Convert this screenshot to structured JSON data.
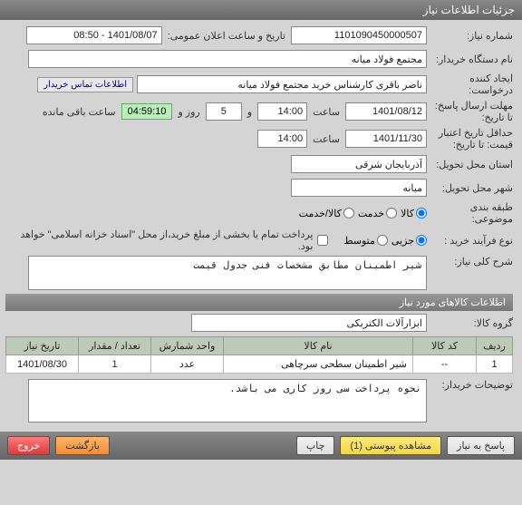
{
  "titlebar": "جزئیات اطلاعات نیاز",
  "labels": {
    "need_no": "شماره نیاز:",
    "announce_dt": "تاریخ و ساعت اعلان عمومی:",
    "buyer_org": "نام دستگاه خریدار:",
    "requester": "ایجاد کننده درخواست:",
    "contact_info": "اطلاعات تماس خریدار",
    "deadline": "مهلت ارسال پاسخ: تا تاریخ:",
    "time": "ساعت",
    "and": "و",
    "day": "روز و",
    "remaining": "ساعت باقی مانده",
    "validity": "حداقل تاریخ اعتبار قیمت: تا تاریخ:",
    "province": "استان محل تحویل:",
    "city": "شهر محل تحویل:",
    "subject_class": "طبقه بندی موضوعی:",
    "goods": "کالا",
    "service": "خدمت",
    "goods_service": "کالا/خدمت",
    "purchase_type": "نوع فرآیند خرید :",
    "partial": "جزیی",
    "medium": "متوسط",
    "payment_note": "پرداخت تمام یا بخشی از مبلغ خرید،از محل \"اسناد خزانه اسلامی\" خواهد بود.",
    "need_desc": "شرح کلی نیاز:",
    "goods_info_header": "اطلاعات کالاهای مورد نیاز",
    "goods_group": "گروه کالا:",
    "buyer_notes": "توضیحات خریدار:"
  },
  "fields": {
    "need_no": "1101090450000507",
    "announce_dt": "1401/08/07 - 08:50",
    "buyer_org": "مجتمع فولاد میانه",
    "requester": "ناصر باقری کارشناس خرید مجتمع فولاد میانه",
    "deadline_date": "1401/08/12",
    "deadline_time": "14:00",
    "days_left": "5",
    "countdown": "04:59:10",
    "validity_date": "1401/11/30",
    "validity_time": "14:00",
    "province": "آذربایجان شرقی",
    "city": "میانه",
    "need_desc": "شیر اطمینان مطابق مشخصات فنی جدول قیمت",
    "goods_group": "ابزارآلات الکتریکی",
    "buyer_notes": "نحوه پرداخت سی روز کاری می باشد."
  },
  "table": {
    "headers": {
      "row": "ردیف",
      "code": "کد کالا",
      "name": "نام کالا",
      "unit": "واحد شمارش",
      "qty": "تعداد / مقدار",
      "need_date": "تاریخ نیاز"
    },
    "rows": [
      {
        "row": "1",
        "code": "--",
        "name": "شیر اطمینان سطحی سرچاهی",
        "unit": "عدد",
        "qty": "1",
        "need_date": "1401/08/30"
      }
    ]
  },
  "footer": {
    "reply": "پاسخ به نیاز",
    "attachments": "مشاهده پیوستی (1)",
    "print": "چاپ",
    "back": "بازگشت",
    "exit": "خروج"
  }
}
